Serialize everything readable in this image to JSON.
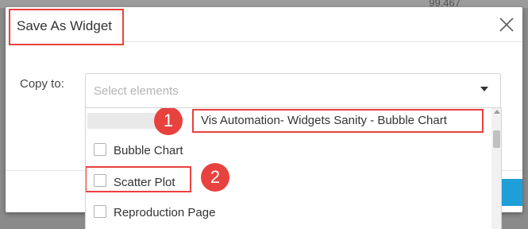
{
  "background": {
    "partial_value": "99.467"
  },
  "dialog": {
    "title": "Save As Widget",
    "close_icon": "close-icon",
    "copy_to_label": "Copy to:",
    "select": {
      "placeholder": "Select elements",
      "caret_icon": "caret-down-icon"
    },
    "dropdown": {
      "group_label": "Vis Automation- Widgets Sanity - Bubble Chart",
      "options": [
        {
          "label": "Bubble Chart",
          "checked": false
        },
        {
          "label": "Scatter Plot",
          "checked": false
        },
        {
          "label": "Reproduction Page",
          "checked": false
        }
      ]
    }
  },
  "annotations": {
    "badge_1": "1",
    "badge_2": "2",
    "highlight_color": "#e8423f"
  },
  "colors": {
    "primary_button": "#1e9fd8"
  }
}
